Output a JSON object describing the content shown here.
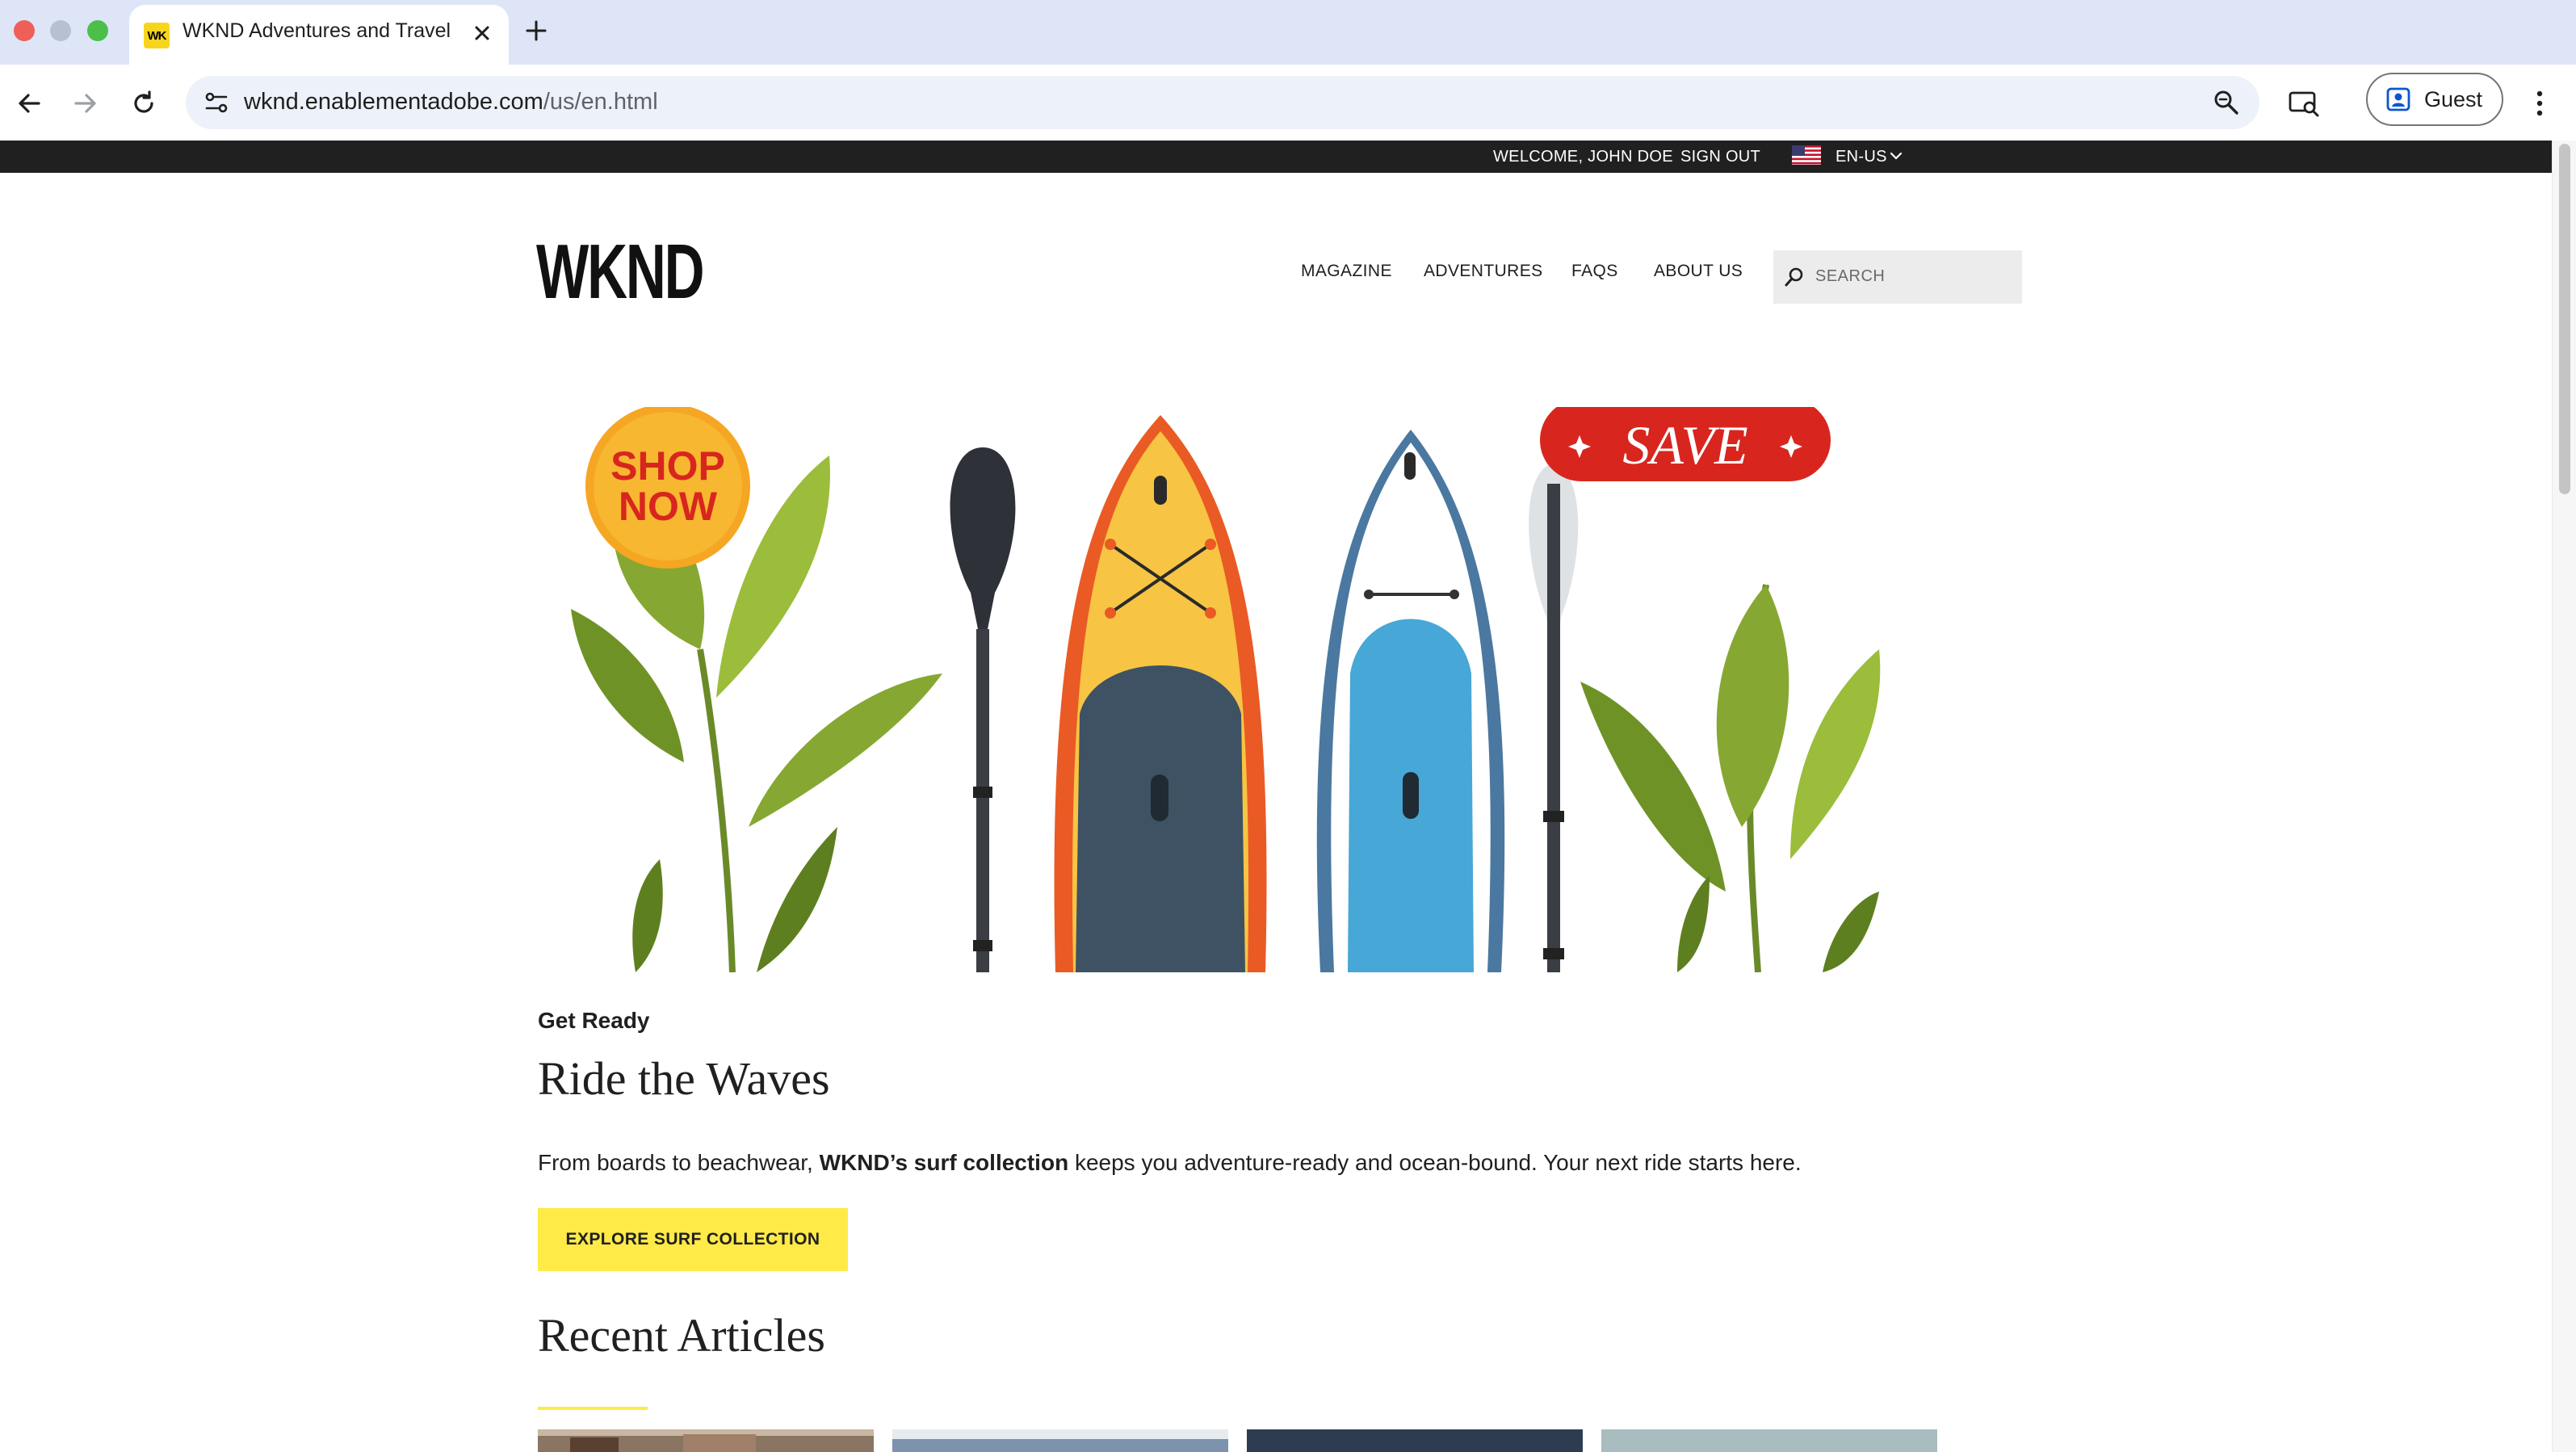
{
  "browser": {
    "tab": {
      "favicon_text": "WK",
      "title": "WKND Adventures and Travel"
    },
    "url": {
      "host": "wknd.enablementadobe.com",
      "path": "/us/en.html"
    },
    "profile_label": "Guest"
  },
  "utility_bar": {
    "welcome": "WELCOME, JOHN DOE",
    "sign_out": "SIGN OUT",
    "language": "EN-US"
  },
  "header": {
    "logo": "WKND",
    "nav": [
      "MAGAZINE",
      "ADVENTURES",
      "FAQS",
      "ABOUT US"
    ],
    "search_placeholder": "SEARCH"
  },
  "hero": {
    "badge_shop": [
      "SHOP",
      "NOW"
    ],
    "badge_save": "SAVE",
    "eyebrow": "Get Ready",
    "title": "Ride the Waves",
    "description_start": "From boards to beachwear, ",
    "description_bold": "WKND’s surf collection",
    "description_end": " keeps you adventure-ready and ocean-bound. Your next ride starts here.",
    "cta": "EXPLORE SURF COLLECTION"
  },
  "recent": {
    "title": "Recent Articles"
  },
  "colors": {
    "accent": "#ffea48",
    "topbar": "#202020",
    "save_red": "#d8261f"
  }
}
